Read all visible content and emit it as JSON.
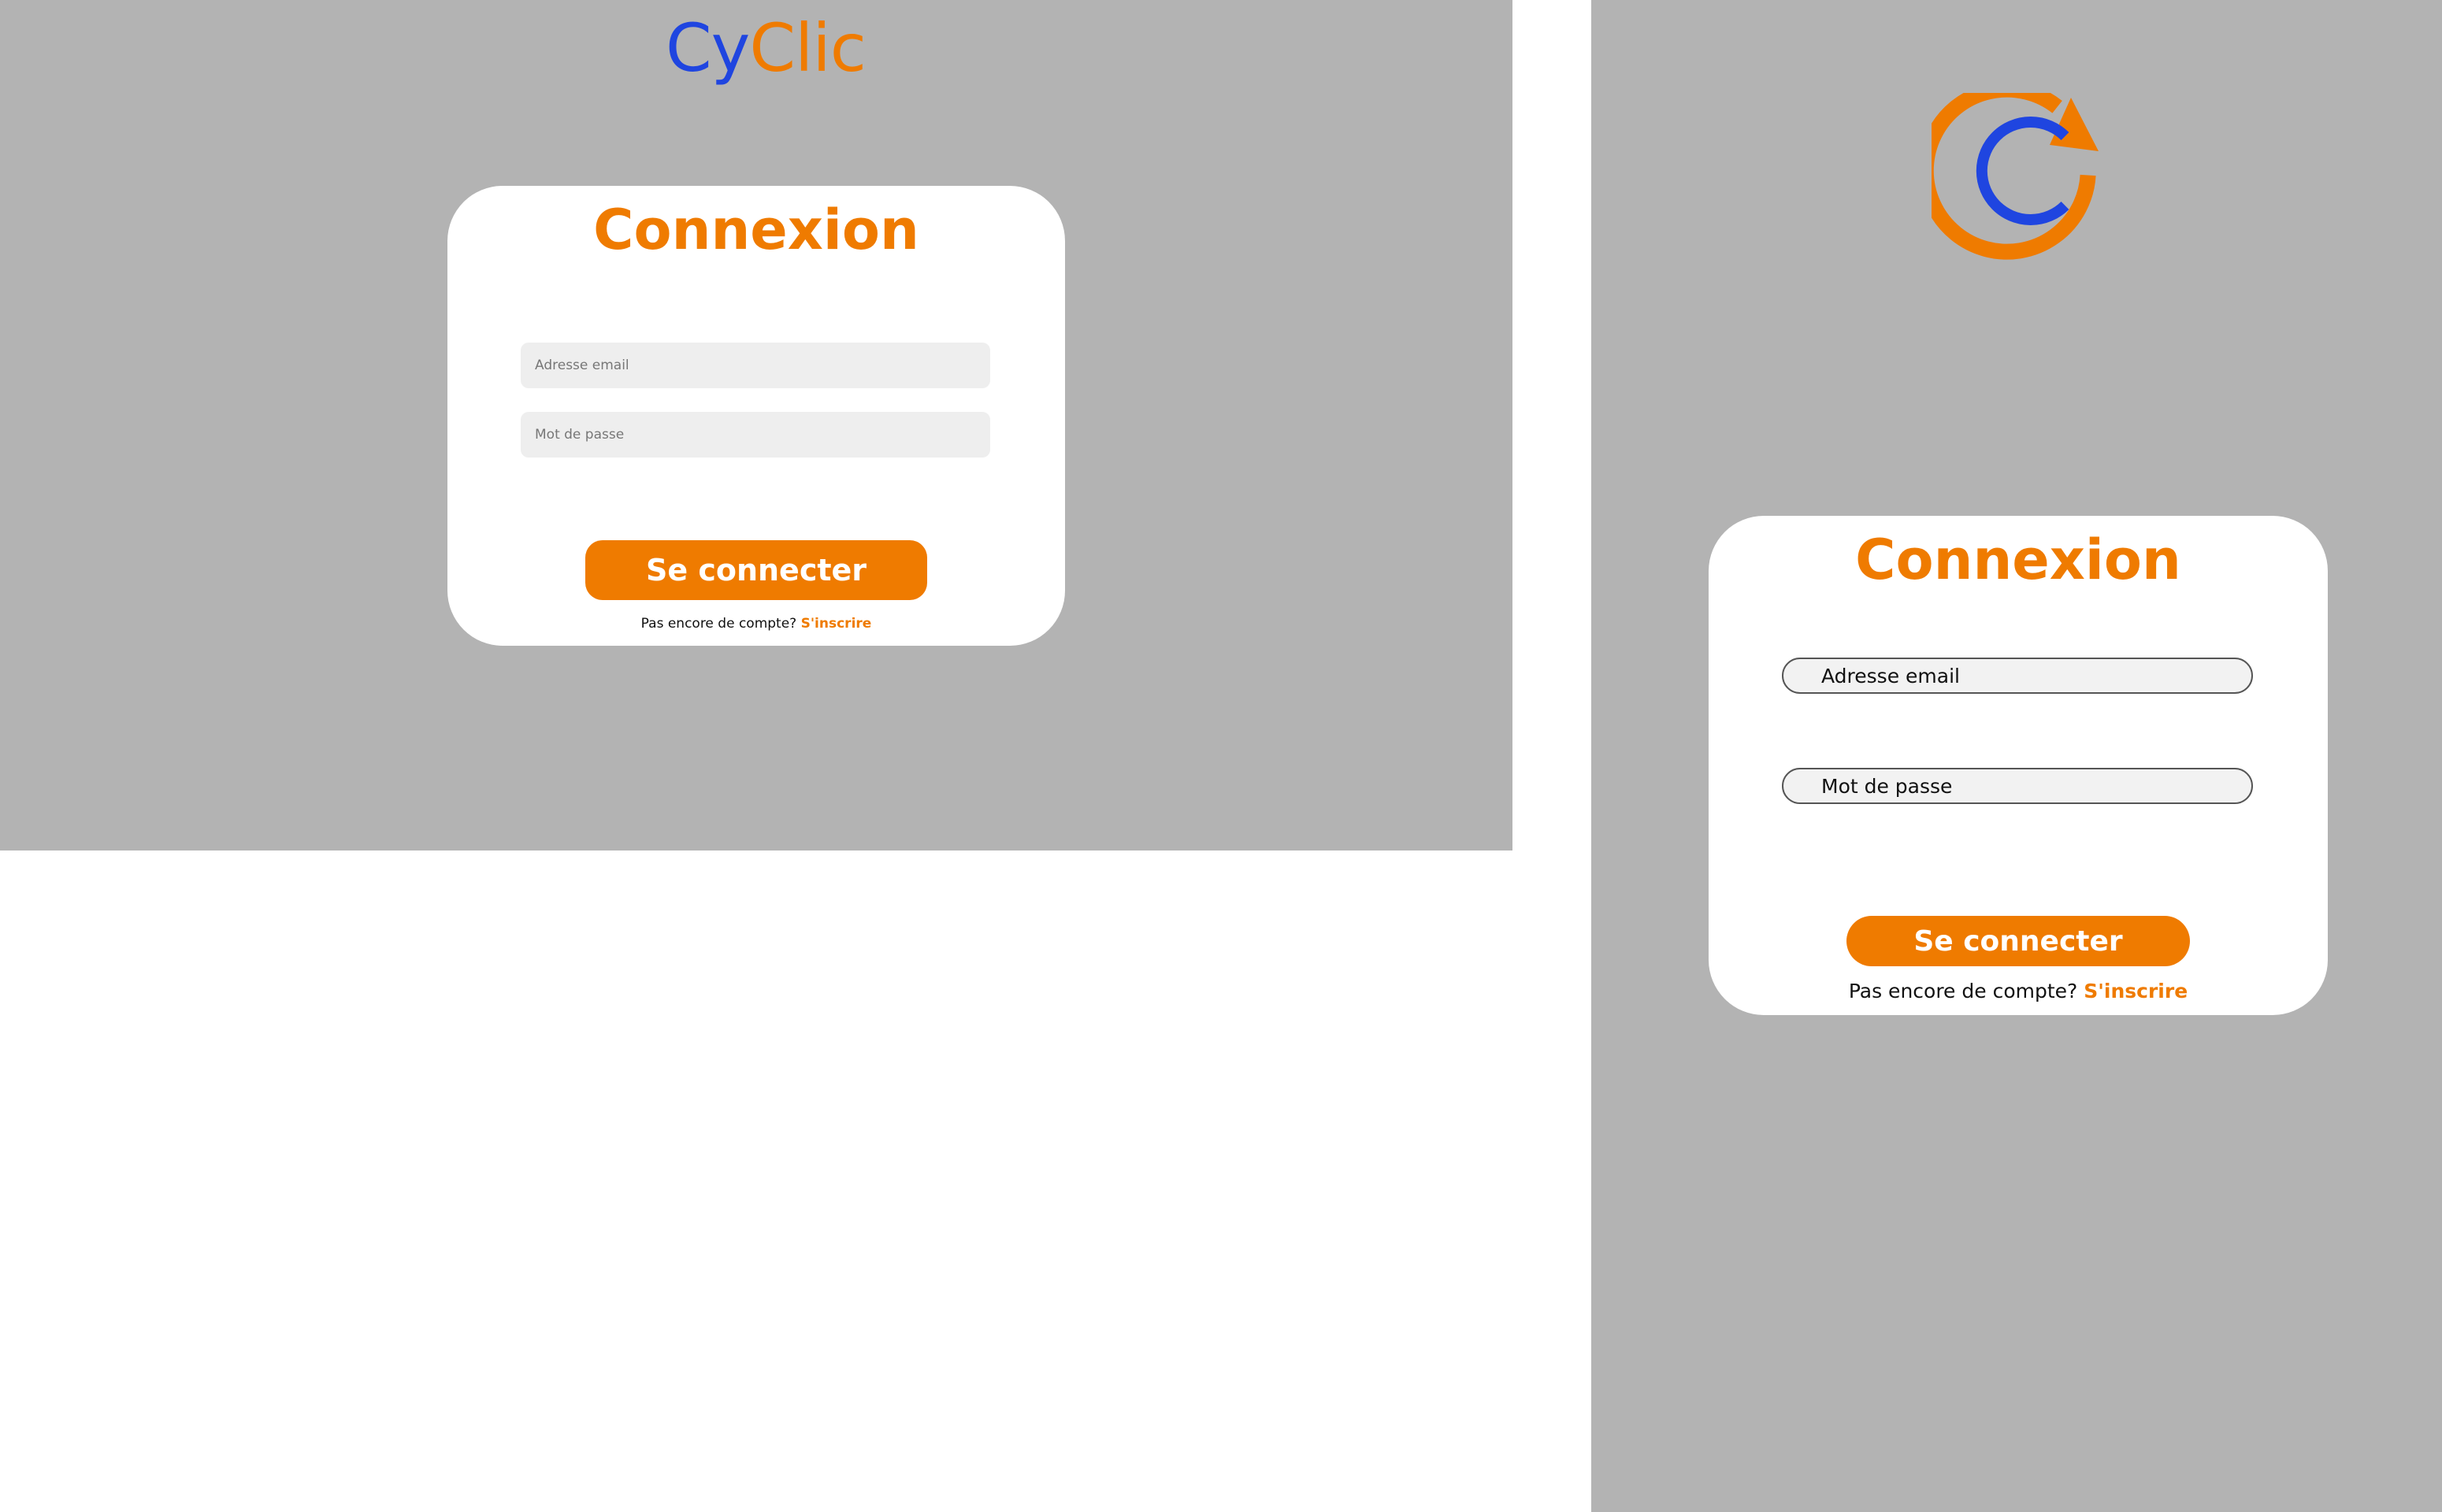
{
  "brand": {
    "name_part1": "Cy",
    "name_part2": "Clic",
    "colors": {
      "primary": "#ef7b00",
      "secondary": "#1f45e0",
      "background": "#b3b3b3",
      "card": "#ffffff"
    }
  },
  "desktop": {
    "title": "Connexion",
    "email_placeholder": "Adresse email",
    "password_placeholder": "Mot de passe",
    "submit_label": "Se connecter",
    "signup_prompt": "Pas encore de compte?",
    "signup_link": "S'inscrire"
  },
  "mobile": {
    "logo_icon": "cyclic-refresh-logo-icon",
    "title": "Connexion",
    "email_placeholder": "Adresse email",
    "password_placeholder": "Mot de passe",
    "submit_label": "Se connecter",
    "signup_prompt": "Pas encore de compte?",
    "signup_link": "S'inscrire"
  }
}
